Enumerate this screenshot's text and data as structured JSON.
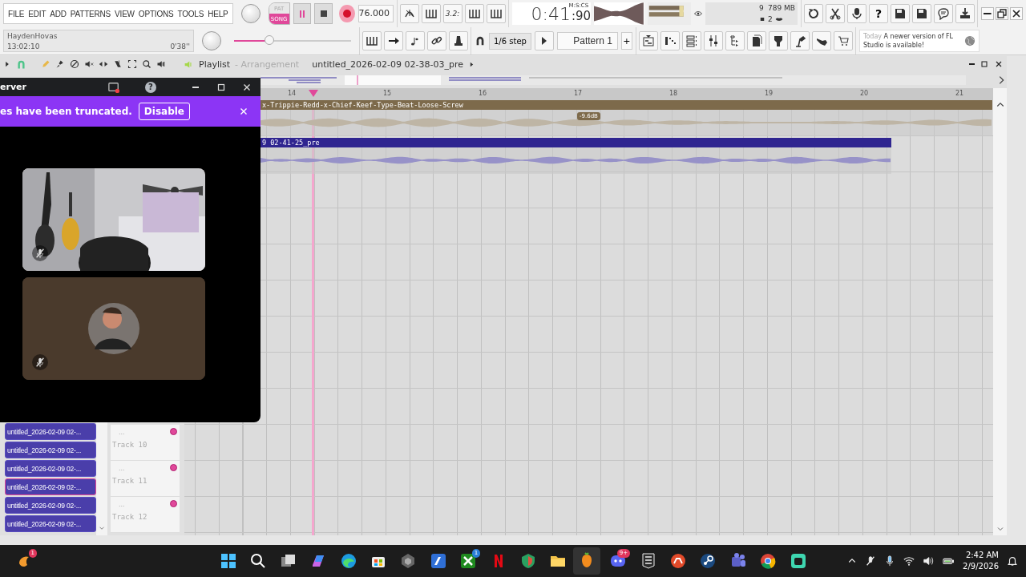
{
  "menu": [
    "FILE",
    "EDIT",
    "ADD",
    "PATTERNS",
    "VIEW",
    "OPTIONS",
    "TOOLS",
    "HELP"
  ],
  "hint": {
    "user": "HaydenHovas",
    "clock": "13:02:10",
    "duration": "0'38''"
  },
  "transport": {
    "modes": [
      {
        "label": "PAT",
        "selected": false
      },
      {
        "label": "SONG",
        "selected": true
      }
    ],
    "tempo": "76.000",
    "countdown": "3.2:",
    "time": "0:41",
    "centiseconds": ":90",
    "time_unit": "M:S:CS",
    "level": 0.3
  },
  "cpu": {
    "polyphony": "9",
    "memory": "789 MB",
    "cores": "2"
  },
  "help": "?",
  "snap": "1/6 step",
  "pattern": "Pattern 1",
  "pattern_add": "+",
  "news": {
    "when": "Today",
    "text": "A newer version of FL Studio is available!"
  },
  "playlist": {
    "title": "Playlist",
    "subtitle": "- Arrangement",
    "song": "untitled_2026-02-09 02-38-03_pre",
    "ruler": [
      "14",
      "15",
      "16",
      "17",
      "18",
      "19",
      "20",
      "21"
    ],
    "clips": [
      {
        "name": "x-Trippie-Redd-x-Chief-Keef-Type-Beat-Loose-Screw",
        "color": "#7d6a4b",
        "tag": "-9.6dB"
      },
      {
        "name": "9 02-41-25_pre",
        "color": "#2f2590"
      }
    ],
    "tracks": [
      {
        "name": "Track 10",
        "more": "..."
      },
      {
        "name": "Track 11",
        "more": "..."
      },
      {
        "name": "Track 12",
        "more": "..."
      }
    ],
    "browser": [
      {
        "name": "untitled_2026-02-09 02-...",
        "selected": false
      },
      {
        "name": "untitled_2026-02-09 02-...",
        "selected": false
      },
      {
        "name": "untitled_2026-02-09 02-...",
        "selected": false
      },
      {
        "name": "untitled_2026-02-09 02-...",
        "selected": true
      },
      {
        "name": "untitled_2026-02-09 02-...",
        "selected": false
      },
      {
        "name": "untitled_2026-02-09 02-...",
        "selected": false
      }
    ]
  },
  "overlay": {
    "title": "erver",
    "help": "?",
    "banner": "es have been truncated.",
    "action": "Disable",
    "tiles": [
      {
        "kind": "camera",
        "muted": true
      },
      {
        "kind": "avatar",
        "muted": true
      }
    ]
  },
  "taskbar": {
    "items": [
      {
        "kind": "start",
        "selected": false
      },
      {
        "kind": "search",
        "selected": false
      },
      {
        "kind": "taskview",
        "selected": false
      },
      {
        "kind": "copilot",
        "selected": false
      },
      {
        "kind": "edge",
        "selected": false
      },
      {
        "kind": "store",
        "selected": false
      },
      {
        "kind": "cube",
        "selected": false
      },
      {
        "kind": "blueapp",
        "selected": false
      },
      {
        "kind": "xbox",
        "badge": "1",
        "selected": false
      },
      {
        "kind": "netflix",
        "selected": false
      },
      {
        "kind": "shield",
        "selected": false
      },
      {
        "kind": "folder",
        "selected": false
      },
      {
        "kind": "fl",
        "selected": true
      },
      {
        "kind": "discord",
        "badge": "9+",
        "selected": false
      },
      {
        "kind": "epic",
        "selected": false
      },
      {
        "kind": "ea",
        "selected": false
      },
      {
        "kind": "steam",
        "selected": false
      },
      {
        "kind": "teams",
        "selected": false
      },
      {
        "kind": "chrome",
        "selected": false
      },
      {
        "kind": "greenapp",
        "selected": false
      }
    ],
    "corner_badge": "1",
    "time": "2:42 AM",
    "date": "2/9/2026"
  }
}
